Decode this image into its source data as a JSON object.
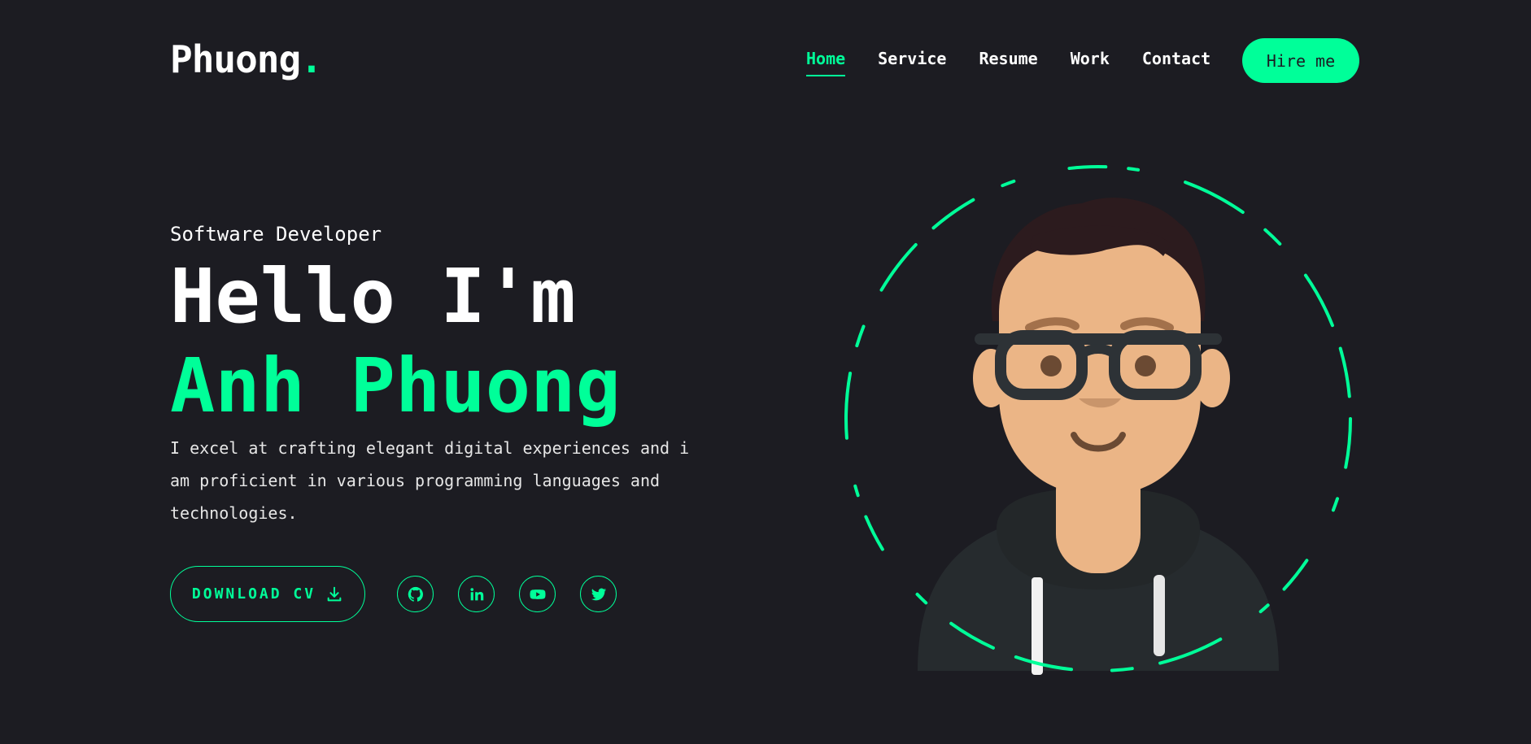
{
  "logo": {
    "text": "Phuong",
    "dot": "."
  },
  "nav": {
    "items": [
      {
        "label": "Home",
        "active": true
      },
      {
        "label": "Service",
        "active": false
      },
      {
        "label": "Resume",
        "active": false
      },
      {
        "label": "Work",
        "active": false
      },
      {
        "label": "Contact",
        "active": false
      }
    ],
    "cta_label": "Hire me"
  },
  "hero": {
    "role": "Software Developer",
    "greeting": "Hello I'm",
    "name": "Anh Phuong",
    "description": "I excel at crafting elegant digital experiences and i am proficient in various programming languages and technologies.",
    "cv_label": "DOWNLOAD CV",
    "socials": [
      "github-icon",
      "linkedin-icon",
      "youtube-icon",
      "twitter-icon"
    ]
  },
  "colors": {
    "accent": "#00ff99",
    "background": "#1c1c22",
    "text": "#ffffff"
  }
}
